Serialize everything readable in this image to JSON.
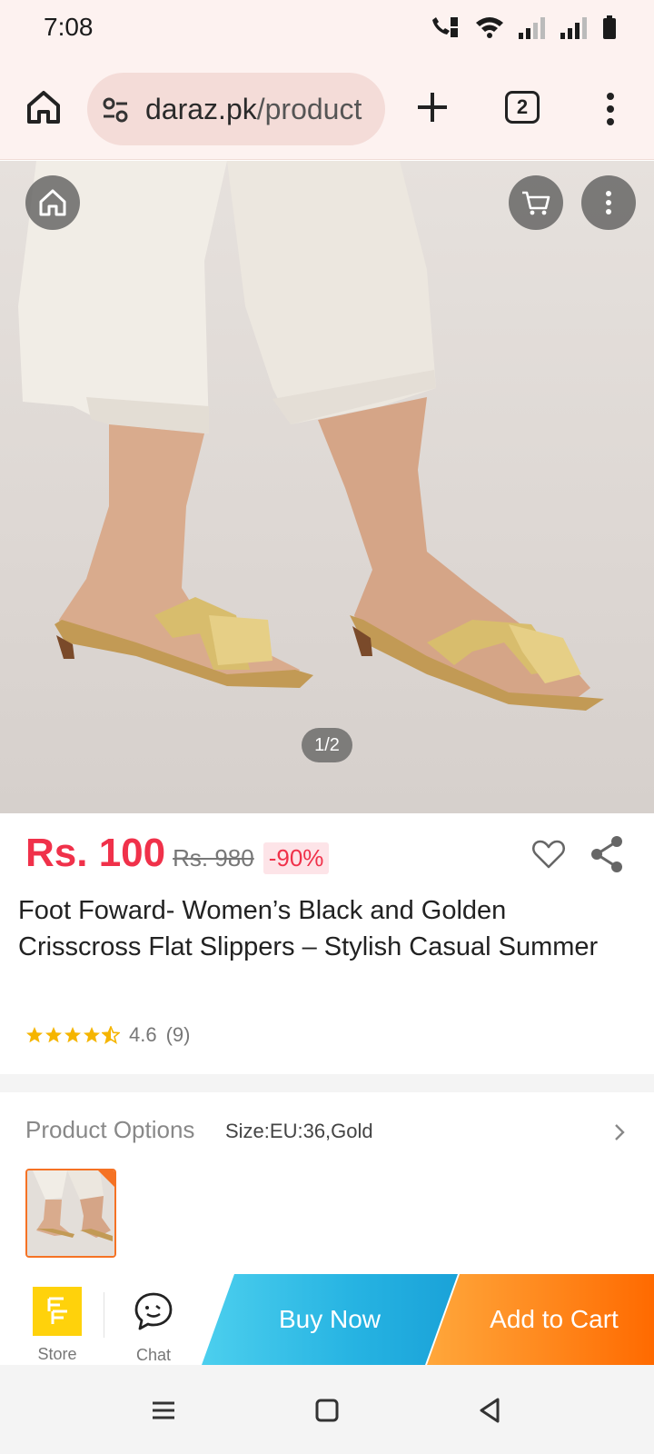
{
  "status_bar": {
    "time": "7:08",
    "icons": [
      "wifi-calling-icon",
      "wifi-icon",
      "signal-icon",
      "signal-icon",
      "battery-icon"
    ]
  },
  "browser": {
    "url_host": "daraz.pk",
    "url_path": "/product",
    "tab_count": "2",
    "icons": [
      "home-icon",
      "site-settings-icon",
      "plus-icon",
      "more-vertical-icon"
    ]
  },
  "gallery": {
    "counter": "1/2",
    "icons": [
      "home-icon",
      "cart-icon",
      "more-vertical-icon"
    ]
  },
  "product": {
    "price": "Rs. 100",
    "original_price": "Rs. 980",
    "discount": "-90%",
    "title": "Foot Foward- Women’s Black and Golden Crisscross Flat Slippers – Stylish Casual Summer",
    "rating_value": 4.6,
    "rating_text": "4.6",
    "review_count": "(9)"
  },
  "options": {
    "label": "Product Options",
    "value": "Size:EU:36,Gold"
  },
  "action_bar": {
    "store_label": "Store",
    "chat_label": "Chat",
    "buy_now_label": "Buy Now",
    "add_to_cart_label": "Add to Cart"
  },
  "colors": {
    "price_red": "#f0314a",
    "star_gold": "#f5b500",
    "buy_now_blue": "#26b3e2",
    "add_to_cart_orange": "#ff8a1f",
    "browser_bar": "#fdf2f0"
  }
}
